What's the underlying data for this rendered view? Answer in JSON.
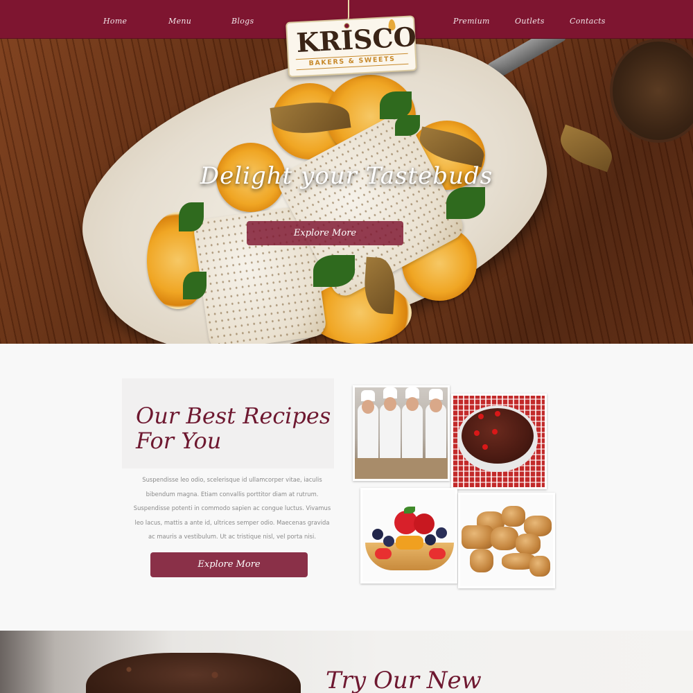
{
  "nav": {
    "left_items": [
      {
        "label": "Home"
      },
      {
        "label": "Menu"
      },
      {
        "label": "Blogs"
      }
    ],
    "right_items": [
      {
        "label": "Premium"
      },
      {
        "label": "Outlets"
      },
      {
        "label": "Contacts"
      }
    ]
  },
  "logo": {
    "name": "KRISCO",
    "tagline": "BAKERS & SWEETS"
  },
  "hero": {
    "title": "Delight your Tastebuds",
    "button_label": "Explore More"
  },
  "recipes": {
    "title_line1": "Our Best Recipes",
    "title_line2": "For You",
    "body": "Suspendisse leo odio, scelerisque id ullamcorper vitae, iaculis bibendum magna. Etiam convallis porttitor diam at rutrum. Suspendisse potenti in commodo sapien ac congue luctus. Vivamus leo lacus, mattis a ante id, ultrices semper odio. Maecenas gravida ac mauris a vestibulum. Ut ac tristique nisl, vel porta nisi.",
    "button_label": "Explore More"
  },
  "bottom": {
    "title": "Try Our New"
  },
  "colors": {
    "brand": "#7e1530",
    "button": "#8a3048",
    "heading": "#6e1830",
    "body_text": "#8a8a8a"
  }
}
